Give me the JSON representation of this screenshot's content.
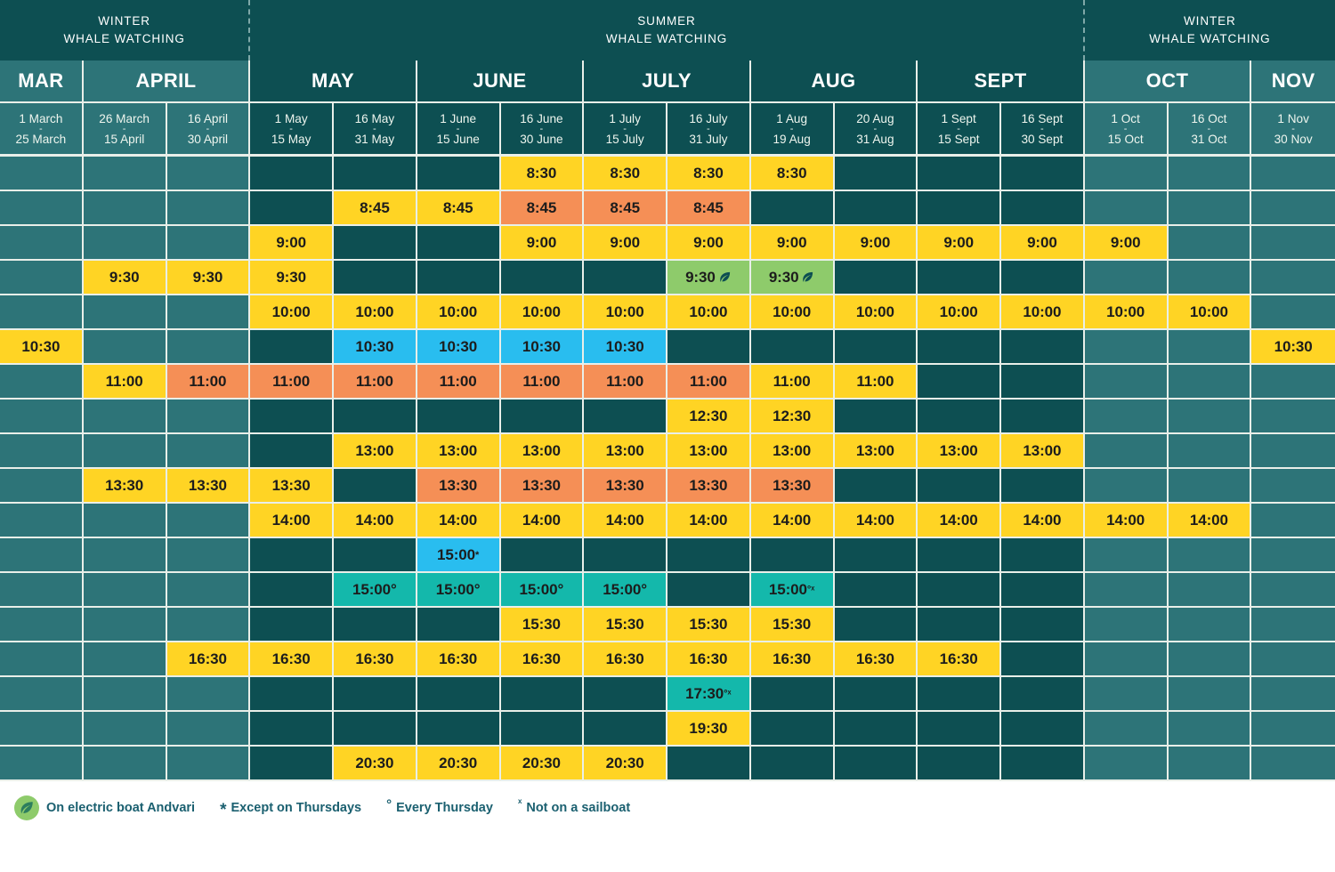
{
  "seasons": [
    {
      "label": "WINTER\nWHALE WATCHING",
      "line1": "WINTER",
      "line2": "WHALE WATCHING",
      "span": 3
    },
    {
      "label": "SUMMER\nWHALE WATCHING",
      "line1": "SUMMER",
      "line2": "WHALE WATCHING",
      "span": 10
    },
    {
      "label": "WINTER\nWHALE WATCHING",
      "line1": "WINTER",
      "line2": "WHALE WATCHING",
      "span": 3
    }
  ],
  "months": [
    {
      "label": "MAR",
      "span": 1,
      "season": "winter"
    },
    {
      "label": "APRIL",
      "span": 2,
      "season": "winter"
    },
    {
      "label": "MAY",
      "span": 2,
      "season": "summer"
    },
    {
      "label": "JUNE",
      "span": 2,
      "season": "summer"
    },
    {
      "label": "JULY",
      "span": 2,
      "season": "summer"
    },
    {
      "label": "AUG",
      "span": 2,
      "season": "summer"
    },
    {
      "label": "SEPT",
      "span": 2,
      "season": "summer"
    },
    {
      "label": "OCT",
      "span": 2,
      "season": "winter"
    },
    {
      "label": "NOV",
      "span": 1,
      "season": "winter"
    }
  ],
  "ranges": [
    {
      "from": "1 March",
      "to": "25 March",
      "season": "winter"
    },
    {
      "from": "26 March",
      "to": "15 April",
      "season": "winter"
    },
    {
      "from": "16 April",
      "to": "30 April",
      "season": "winter"
    },
    {
      "from": "1 May",
      "to": "15 May",
      "season": "summer"
    },
    {
      "from": "16 May",
      "to": "31 May",
      "season": "summer"
    },
    {
      "from": "1 June",
      "to": "15 June",
      "season": "summer"
    },
    {
      "from": "16 June",
      "to": "30 June",
      "season": "summer"
    },
    {
      "from": "1 July",
      "to": "15 July",
      "season": "summer"
    },
    {
      "from": "16 July",
      "to": "31 July",
      "season": "summer"
    },
    {
      "from": "1 Aug",
      "to": "19 Aug",
      "season": "summer"
    },
    {
      "from": "20 Aug",
      "to": "31 Aug",
      "season": "summer"
    },
    {
      "from": "1 Sept",
      "to": "15 Sept",
      "season": "summer"
    },
    {
      "from": "16 Sept",
      "to": "30 Sept",
      "season": "summer"
    },
    {
      "from": "1 Oct",
      "to": "15 Oct",
      "season": "winter"
    },
    {
      "from": "16 Oct",
      "to": "31 Oct",
      "season": "winter"
    },
    {
      "from": "1 Nov",
      "to": "30 Nov",
      "season": "winter"
    }
  ],
  "column_seasons": [
    "winter",
    "winter",
    "winter",
    "summer",
    "summer",
    "summer",
    "summer",
    "summer",
    "summer",
    "summer",
    "summer",
    "summer",
    "summer",
    "winter",
    "winter",
    "winter"
  ],
  "colors": {
    "winter_header": "#2d7478",
    "summer_header": "#0d4f52",
    "yellow": "#ffd424",
    "orange": "#f58f56",
    "cyan": "#29bdef",
    "teal": "#14b8ab",
    "green": "#8ecb6b",
    "grid_line": "#e9efe9",
    "legend_text": "#1b6070"
  },
  "rows": [
    {
      "time": "8:30",
      "cells": [
        null,
        null,
        null,
        null,
        null,
        null,
        {
          "t": "8:30",
          "c": "yellow"
        },
        {
          "t": "8:30",
          "c": "yellow"
        },
        {
          "t": "8:30",
          "c": "yellow"
        },
        {
          "t": "8:30",
          "c": "yellow"
        },
        null,
        null,
        null,
        null,
        null,
        null
      ]
    },
    {
      "time": "8:45",
      "cells": [
        null,
        null,
        null,
        null,
        {
          "t": "8:45",
          "c": "yellow"
        },
        {
          "t": "8:45",
          "c": "yellow"
        },
        {
          "t": "8:45",
          "c": "orange"
        },
        {
          "t": "8:45",
          "c": "orange"
        },
        {
          "t": "8:45",
          "c": "orange"
        },
        null,
        null,
        null,
        null,
        null,
        null,
        null
      ]
    },
    {
      "time": "9:00",
      "cells": [
        null,
        null,
        null,
        {
          "t": "9:00",
          "c": "yellow"
        },
        null,
        null,
        {
          "t": "9:00",
          "c": "yellow"
        },
        {
          "t": "9:00",
          "c": "yellow"
        },
        {
          "t": "9:00",
          "c": "yellow"
        },
        {
          "t": "9:00",
          "c": "yellow"
        },
        {
          "t": "9:00",
          "c": "yellow"
        },
        {
          "t": "9:00",
          "c": "yellow"
        },
        {
          "t": "9:00",
          "c": "yellow"
        },
        {
          "t": "9:00",
          "c": "yellow"
        },
        null,
        null
      ]
    },
    {
      "time": "9:30",
      "cells": [
        null,
        {
          "t": "9:30",
          "c": "yellow"
        },
        {
          "t": "9:30",
          "c": "yellow"
        },
        {
          "t": "9:30",
          "c": "yellow"
        },
        null,
        null,
        null,
        null,
        {
          "t": "9:30",
          "c": "green",
          "leaf": true
        },
        {
          "t": "9:30",
          "c": "green",
          "leaf": true
        },
        null,
        null,
        null,
        null,
        null,
        null
      ]
    },
    {
      "time": "10:00",
      "cells": [
        null,
        null,
        null,
        {
          "t": "10:00",
          "c": "yellow"
        },
        {
          "t": "10:00",
          "c": "yellow"
        },
        {
          "t": "10:00",
          "c": "yellow"
        },
        {
          "t": "10:00",
          "c": "yellow"
        },
        {
          "t": "10:00",
          "c": "yellow"
        },
        {
          "t": "10:00",
          "c": "yellow"
        },
        {
          "t": "10:00",
          "c": "yellow"
        },
        {
          "t": "10:00",
          "c": "yellow"
        },
        {
          "t": "10:00",
          "c": "yellow"
        },
        {
          "t": "10:00",
          "c": "yellow"
        },
        {
          "t": "10:00",
          "c": "yellow"
        },
        {
          "t": "10:00",
          "c": "yellow"
        },
        null
      ]
    },
    {
      "time": "10:30",
      "cells": [
        {
          "t": "10:30",
          "c": "yellow"
        },
        null,
        null,
        null,
        {
          "t": "10:30",
          "c": "cyan"
        },
        {
          "t": "10:30",
          "c": "cyan"
        },
        {
          "t": "10:30",
          "c": "cyan"
        },
        {
          "t": "10:30",
          "c": "cyan"
        },
        null,
        null,
        null,
        null,
        null,
        null,
        null,
        {
          "t": "10:30",
          "c": "yellow"
        }
      ]
    },
    {
      "time": "11:00",
      "cells": [
        null,
        {
          "t": "11:00",
          "c": "yellow"
        },
        {
          "t": "11:00",
          "c": "orange"
        },
        {
          "t": "11:00",
          "c": "orange"
        },
        {
          "t": "11:00",
          "c": "orange"
        },
        {
          "t": "11:00",
          "c": "orange"
        },
        {
          "t": "11:00",
          "c": "orange"
        },
        {
          "t": "11:00",
          "c": "orange"
        },
        {
          "t": "11:00",
          "c": "orange"
        },
        {
          "t": "11:00",
          "c": "yellow"
        },
        {
          "t": "11:00",
          "c": "yellow"
        },
        null,
        null,
        null,
        null,
        null
      ]
    },
    {
      "time": "12:30",
      "cells": [
        null,
        null,
        null,
        null,
        null,
        null,
        null,
        null,
        {
          "t": "12:30",
          "c": "yellow"
        },
        {
          "t": "12:30",
          "c": "yellow"
        },
        null,
        null,
        null,
        null,
        null,
        null
      ]
    },
    {
      "time": "13:00",
      "cells": [
        null,
        null,
        null,
        null,
        {
          "t": "13:00",
          "c": "yellow"
        },
        {
          "t": "13:00",
          "c": "yellow"
        },
        {
          "t": "13:00",
          "c": "yellow"
        },
        {
          "t": "13:00",
          "c": "yellow"
        },
        {
          "t": "13:00",
          "c": "yellow"
        },
        {
          "t": "13:00",
          "c": "yellow"
        },
        {
          "t": "13:00",
          "c": "yellow"
        },
        {
          "t": "13:00",
          "c": "yellow"
        },
        {
          "t": "13:00",
          "c": "yellow"
        },
        null,
        null,
        null
      ]
    },
    {
      "time": "13:30",
      "cells": [
        null,
        {
          "t": "13:30",
          "c": "yellow"
        },
        {
          "t": "13:30",
          "c": "yellow"
        },
        {
          "t": "13:30",
          "c": "yellow"
        },
        null,
        {
          "t": "13:30",
          "c": "orange"
        },
        {
          "t": "13:30",
          "c": "orange"
        },
        {
          "t": "13:30",
          "c": "orange"
        },
        {
          "t": "13:30",
          "c": "orange"
        },
        {
          "t": "13:30",
          "c": "orange"
        },
        null,
        null,
        null,
        null,
        null,
        null
      ]
    },
    {
      "time": "14:00",
      "cells": [
        null,
        null,
        null,
        {
          "t": "14:00",
          "c": "yellow"
        },
        {
          "t": "14:00",
          "c": "yellow"
        },
        {
          "t": "14:00",
          "c": "yellow"
        },
        {
          "t": "14:00",
          "c": "yellow"
        },
        {
          "t": "14:00",
          "c": "yellow"
        },
        {
          "t": "14:00",
          "c": "yellow"
        },
        {
          "t": "14:00",
          "c": "yellow"
        },
        {
          "t": "14:00",
          "c": "yellow"
        },
        {
          "t": "14:00",
          "c": "yellow"
        },
        {
          "t": "14:00",
          "c": "yellow"
        },
        {
          "t": "14:00",
          "c": "yellow"
        },
        {
          "t": "14:00",
          "c": "yellow"
        },
        null
      ]
    },
    {
      "time": "15:00*",
      "cells": [
        null,
        null,
        null,
        null,
        null,
        {
          "t": "15:00",
          "c": "cyan",
          "mark": "*"
        },
        null,
        null,
        null,
        null,
        null,
        null,
        null,
        null,
        null,
        null
      ]
    },
    {
      "time": "15:00°",
      "cells": [
        null,
        null,
        null,
        null,
        {
          "t": "15:00",
          "c": "teal",
          "mark": "°"
        },
        {
          "t": "15:00",
          "c": "teal",
          "mark": "°"
        },
        {
          "t": "15:00",
          "c": "teal",
          "mark": "°"
        },
        {
          "t": "15:00",
          "c": "teal",
          "mark": "°"
        },
        null,
        {
          "t": "15:00",
          "c": "teal",
          "mark": "°ˣ"
        },
        null,
        null,
        null,
        null,
        null,
        null
      ]
    },
    {
      "time": "15:30",
      "cells": [
        null,
        null,
        null,
        null,
        null,
        null,
        {
          "t": "15:30",
          "c": "yellow"
        },
        {
          "t": "15:30",
          "c": "yellow"
        },
        {
          "t": "15:30",
          "c": "yellow"
        },
        {
          "t": "15:30",
          "c": "yellow"
        },
        null,
        null,
        null,
        null,
        null,
        null
      ]
    },
    {
      "time": "16:30",
      "cells": [
        null,
        null,
        {
          "t": "16:30",
          "c": "yellow"
        },
        {
          "t": "16:30",
          "c": "yellow"
        },
        {
          "t": "16:30",
          "c": "yellow"
        },
        {
          "t": "16:30",
          "c": "yellow"
        },
        {
          "t": "16:30",
          "c": "yellow"
        },
        {
          "t": "16:30",
          "c": "yellow"
        },
        {
          "t": "16:30",
          "c": "yellow"
        },
        {
          "t": "16:30",
          "c": "yellow"
        },
        {
          "t": "16:30",
          "c": "yellow"
        },
        {
          "t": "16:30",
          "c": "yellow"
        },
        null,
        null,
        null,
        null
      ]
    },
    {
      "time": "17:30°ˣ",
      "cells": [
        null,
        null,
        null,
        null,
        null,
        null,
        null,
        null,
        {
          "t": "17:30",
          "c": "teal",
          "mark": "°ˣ"
        },
        null,
        null,
        null,
        null,
        null,
        null,
        null
      ]
    },
    {
      "time": "19:30",
      "cells": [
        null,
        null,
        null,
        null,
        null,
        null,
        null,
        null,
        {
          "t": "19:30",
          "c": "yellow"
        },
        null,
        null,
        null,
        null,
        null,
        null,
        null
      ]
    },
    {
      "time": "20:30",
      "cells": [
        null,
        null,
        null,
        null,
        {
          "t": "20:30",
          "c": "yellow"
        },
        {
          "t": "20:30",
          "c": "yellow"
        },
        {
          "t": "20:30",
          "c": "yellow"
        },
        {
          "t": "20:30",
          "c": "yellow"
        },
        null,
        null,
        null,
        null,
        null,
        null,
        null,
        null
      ]
    }
  ],
  "legend": [
    {
      "icon": "leaf-badge-icon",
      "mark": "",
      "text": "On electric boat Andvari"
    },
    {
      "icon": "",
      "mark": "*",
      "text": "Except on Thursdays"
    },
    {
      "icon": "",
      "mark": "°",
      "text": "Every Thursday"
    },
    {
      "icon": "",
      "mark": "ˣ",
      "text": "Not on a sailboat"
    }
  ]
}
